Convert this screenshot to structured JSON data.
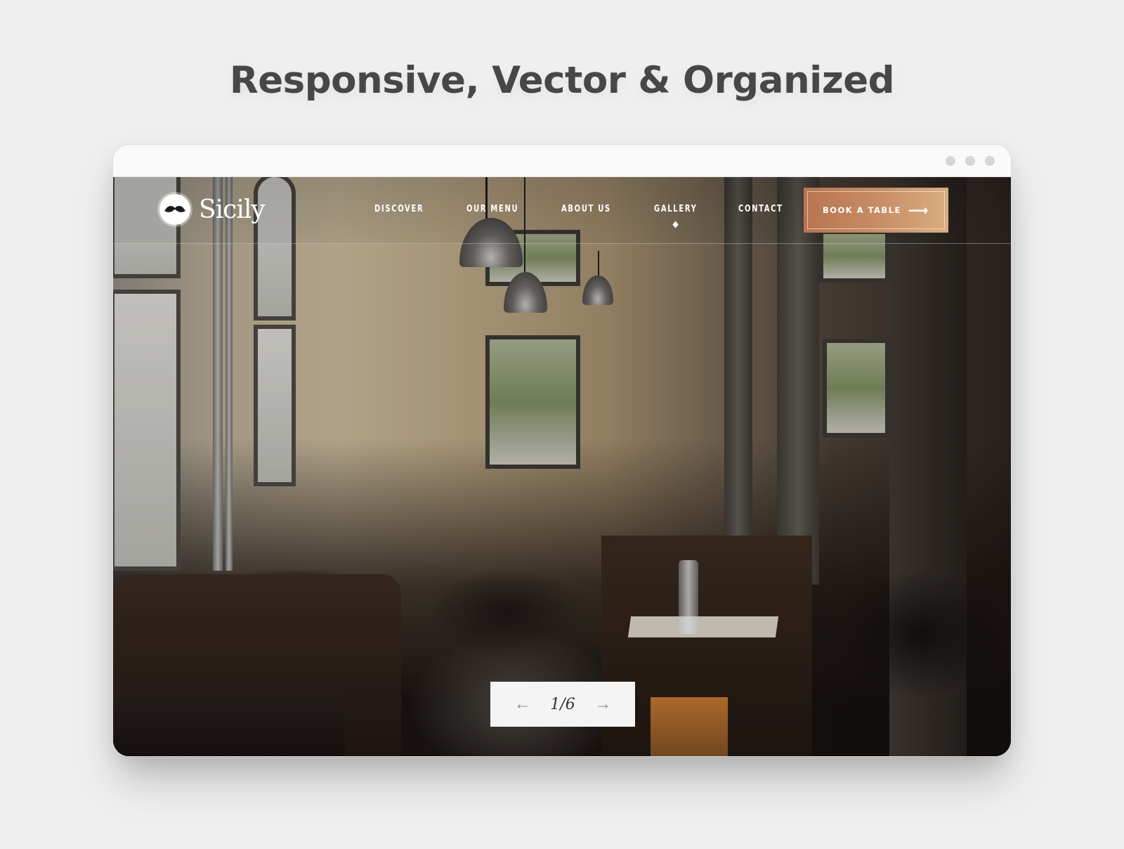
{
  "headline": "Responsive, Vector & Organized",
  "browser": {
    "window_controls": [
      "dot",
      "dot",
      "dot"
    ]
  },
  "site": {
    "logo": {
      "icon": "mustache-icon",
      "name": "Sicily"
    },
    "nav": [
      {
        "label": "Discover",
        "active": false
      },
      {
        "label": "Our Menu",
        "active": false
      },
      {
        "label": "About Us",
        "active": false
      },
      {
        "label": "Gallery",
        "active": true
      },
      {
        "label": "Contact",
        "active": false
      }
    ],
    "cta": {
      "label": "BOOK A TABLE",
      "icon": "arrow-right-icon",
      "arrow": "⟶"
    },
    "hero": {
      "image_description": "Busy restaurant interior with stone walls, tall windows, pendant lamps and diners"
    },
    "slider": {
      "prev_icon": "arrow-left-icon",
      "prev_glyph": "←",
      "counter": "1/6",
      "current": 1,
      "total": 6,
      "next_icon": "arrow-right-icon",
      "next_glyph": "→"
    }
  },
  "colors": {
    "page_bg": "#efefef",
    "headline": "#474747",
    "cta_start": "#b7744f",
    "cta_end": "#d9ae7f",
    "pager_bg": "#f4f4f4"
  }
}
